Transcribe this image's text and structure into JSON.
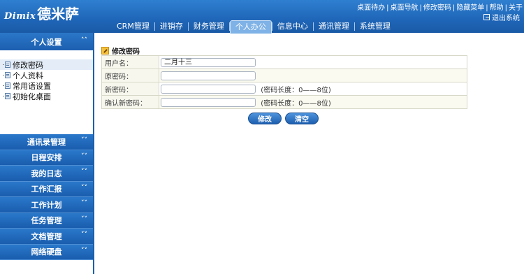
{
  "brand": {
    "logo_en": "Dimix",
    "logo_cn": "德米萨"
  },
  "top_links": [
    "桌面待办",
    "桌面导航",
    "修改密码",
    "隐藏菜单",
    "帮助",
    "关于"
  ],
  "exit_label": "退出系统",
  "main_nav": [
    "CRM管理",
    "进销存",
    "财务管理",
    "个人办公",
    "信息中心",
    "通讯管理",
    "系统管理"
  ],
  "main_nav_active": "个人办公",
  "sidebar": {
    "title": "个人设置",
    "items": [
      "修改密码",
      "个人资料",
      "常用语设置",
      "初始化桌面"
    ],
    "selected": "修改密码",
    "menu": [
      "通讯录管理",
      "日程安排",
      "我的日志",
      "工作汇报",
      "工作计划",
      "任务管理",
      "文档管理",
      "网络硬盘"
    ]
  },
  "form": {
    "title": "修改密码",
    "rows": [
      {
        "label": "用户名：",
        "value": "二月十三",
        "hint": ""
      },
      {
        "label": "原密码：",
        "value": "",
        "hint": ""
      },
      {
        "label": "新密码：",
        "value": "",
        "hint": "(密码长度：0——8位)"
      },
      {
        "label": "确认新密码：",
        "value": "",
        "hint": "(密码长度：0——8位)"
      }
    ],
    "submit_label": "修改",
    "clear_label": "清空"
  }
}
